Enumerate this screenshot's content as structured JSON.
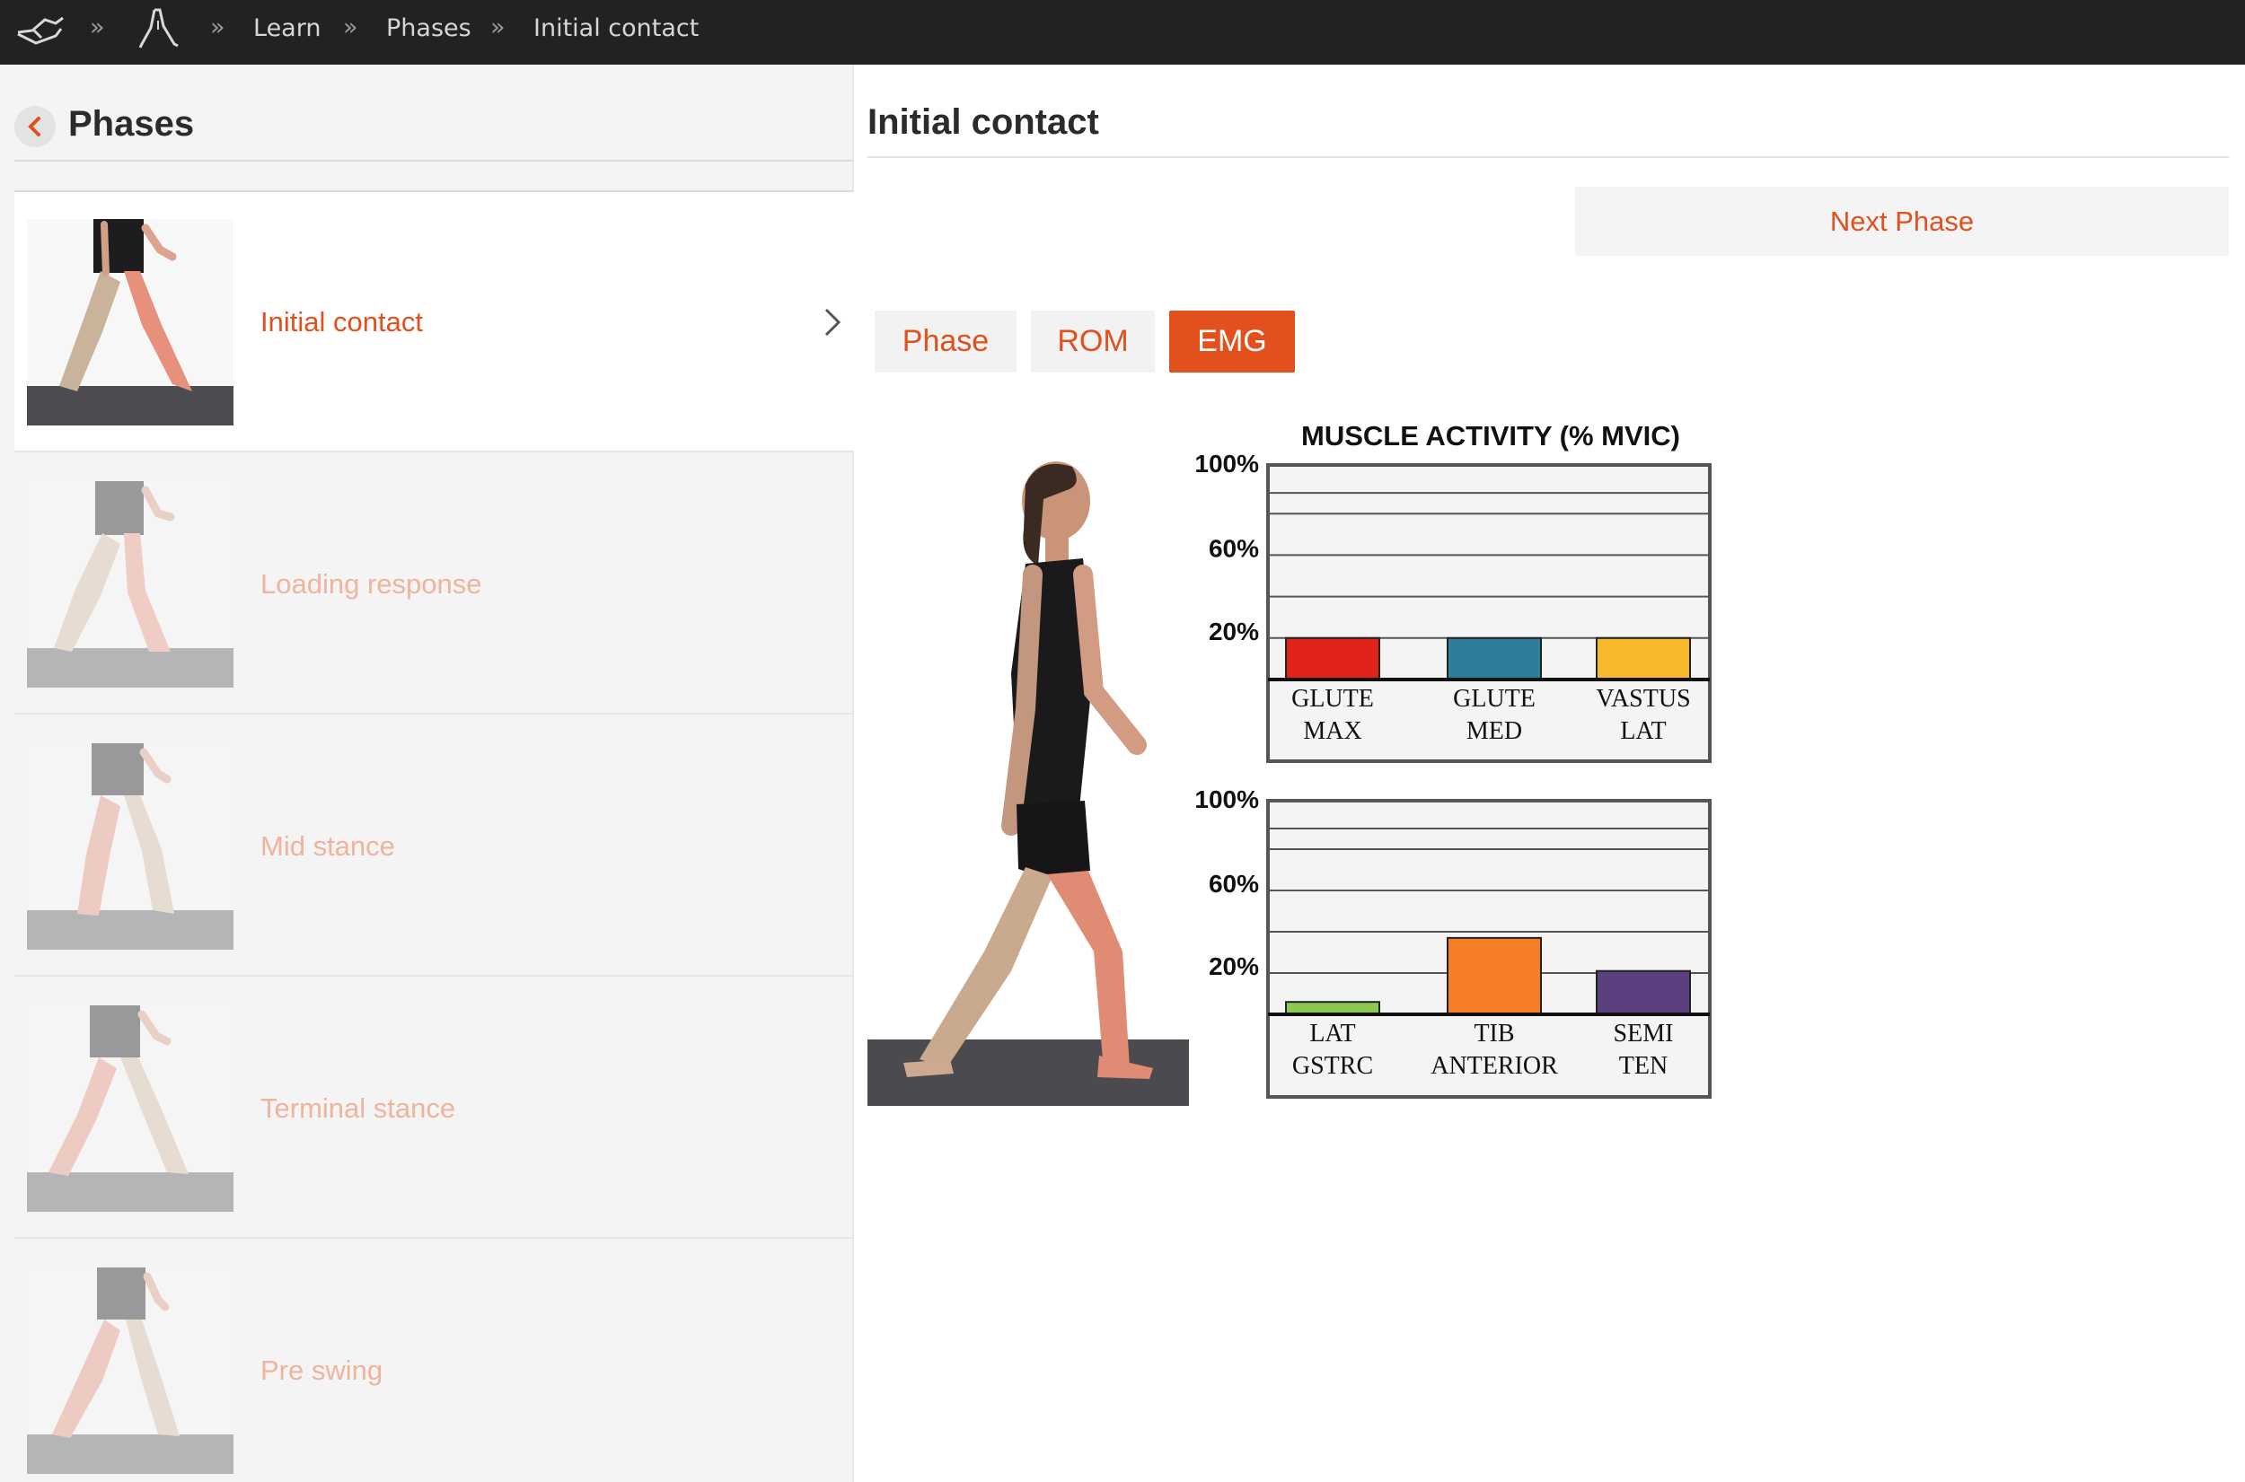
{
  "breadcrumb": {
    "separator": "»",
    "items": [
      "Learn",
      "Phases",
      "Initial contact"
    ]
  },
  "sidebar": {
    "title": "Phases",
    "items": [
      {
        "label": "Initial contact",
        "active": true
      },
      {
        "label": "Loading response",
        "active": false
      },
      {
        "label": "Mid stance",
        "active": false
      },
      {
        "label": "Terminal stance",
        "active": false
      },
      {
        "label": "Pre swing",
        "active": false
      }
    ]
  },
  "main": {
    "title": "Initial contact",
    "next_label": "Next Phase",
    "tabs": [
      {
        "label": "Phase",
        "selected": false
      },
      {
        "label": "ROM",
        "selected": false
      },
      {
        "label": "EMG",
        "selected": true
      }
    ]
  },
  "colors": {
    "accent": "#e2501d",
    "accent_faded": "#f0b49d",
    "topbar": "#222222",
    "panel": "#f4f4f4"
  },
  "chart_data": [
    {
      "type": "bar",
      "title": "MUSCLE ACTIVITY (% MVIC)",
      "categories": [
        "GLUTE MAX",
        "GLUTE MED",
        "VASTUS LAT"
      ],
      "category_lines": [
        [
          "GLUTE",
          "MAX"
        ],
        [
          "GLUTE",
          "MED"
        ],
        [
          "VASTUS",
          "LAT"
        ]
      ],
      "values": [
        20,
        20,
        20
      ],
      "colors": [
        "#e2231a",
        "#2f7e99",
        "#f8b82b"
      ],
      "yticks": [
        "100%",
        "60%",
        "20%"
      ],
      "ylim": [
        0,
        100
      ],
      "grid": true
    },
    {
      "type": "bar",
      "title": "",
      "categories": [
        "LAT GSTRC",
        "TIB ANTERIOR",
        "SEMI TEN"
      ],
      "category_lines": [
        [
          "LAT",
          "GSTRC"
        ],
        [
          "TIB",
          "ANTERIOR"
        ],
        [
          "SEMI",
          "TEN"
        ]
      ],
      "values": [
        6,
        37,
        21
      ],
      "colors": [
        "#8bc751",
        "#f47d26",
        "#5b4080"
      ],
      "yticks": [
        "100%",
        "60%",
        "20%"
      ],
      "ylim": [
        0,
        100
      ],
      "grid": true
    }
  ]
}
